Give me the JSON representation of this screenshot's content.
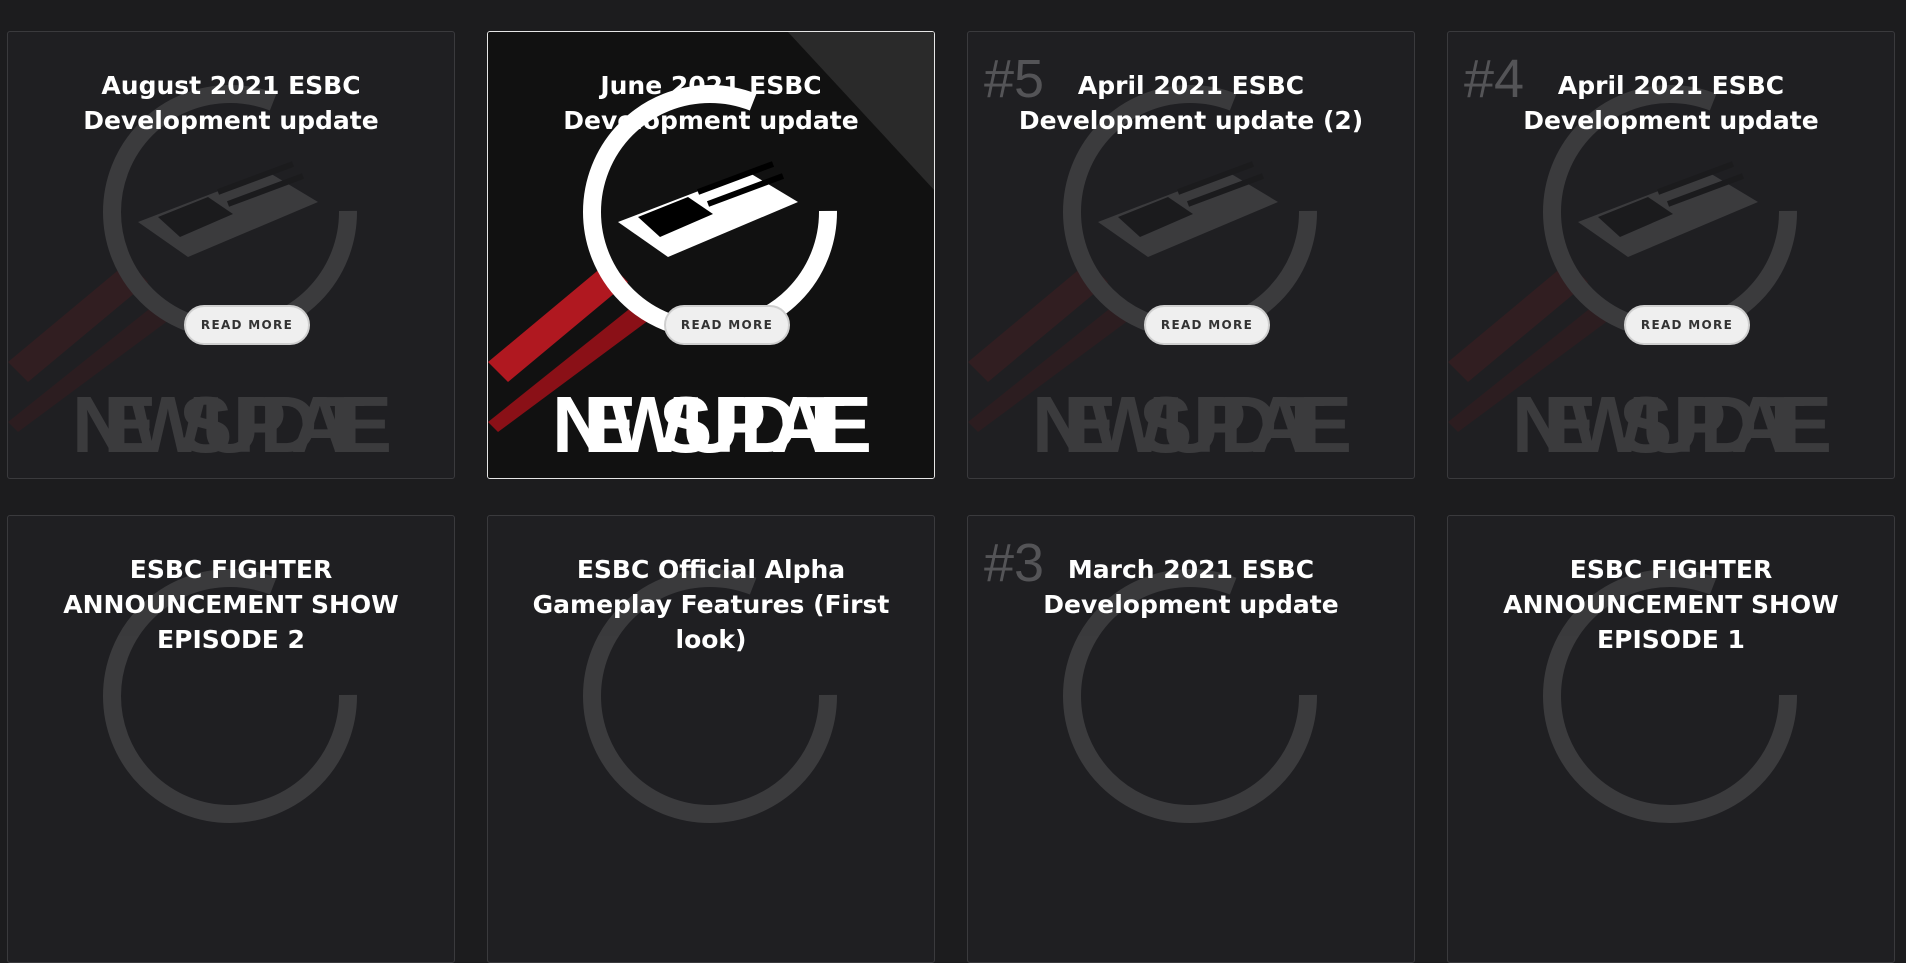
{
  "button_label": "READ MORE",
  "art_text": "NEWS UPDATE",
  "cards": [
    {
      "title": "August 2021 ESBC Development update",
      "number": "",
      "read_more": "READ MORE",
      "active": false
    },
    {
      "title": "June 2021 ESBC Development update",
      "number": "",
      "read_more": "READ MORE",
      "active": true
    },
    {
      "title": "April 2021 ESBC Development update (2)",
      "number": "#5",
      "read_more": "READ MORE",
      "active": false
    },
    {
      "title": "April 2021 ESBC Development update",
      "number": "#4",
      "read_more": "READ MORE",
      "active": false
    },
    {
      "title": "ESBC FIGHTER ANNOUNCEMENT SHOW EPISODE 2",
      "number": "",
      "read_more": "",
      "active": false
    },
    {
      "title": "ESBC Official Alpha Gameplay Features (First look)",
      "number": "",
      "read_more": "",
      "active": false
    },
    {
      "title": "March 2021 ESBC Development update",
      "number": "#3",
      "read_more": "",
      "active": false
    },
    {
      "title": "ESBC FIGHTER ANNOUNCEMENT SHOW EPISODE 1",
      "number": "",
      "read_more": "",
      "active": false
    }
  ],
  "colors": {
    "page_bg": "#1c1c1e",
    "card_border": "#3a3a3d",
    "active_border": "#e6e6e6",
    "accent_red": "#b01820",
    "button_bg": "#efefef"
  }
}
